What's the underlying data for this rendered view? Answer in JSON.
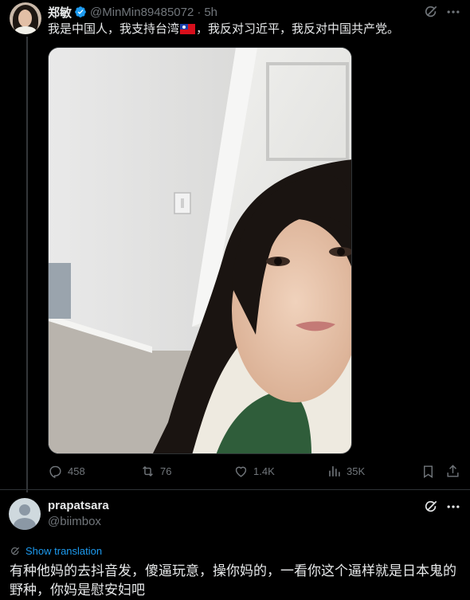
{
  "tweet": {
    "author_name": "郑敏",
    "author_handle": "@MinMin89485072",
    "separator": "·",
    "time": "5h",
    "text_part1": "我是中国人，我支持台湾",
    "text_part2": "，我反对习近平，我反对中国共产党。",
    "flag_icon": "taiwan-flag-emoji",
    "stats": {
      "replies": "458",
      "reposts": "76",
      "likes": "1.4K",
      "views": "35K"
    }
  },
  "reply": {
    "author_name": "prapatsara",
    "author_handle": "@biimbox",
    "show_translation": "Show translation",
    "text": "有种他妈的去抖音发，傻逼玩意，操你妈的，一看你这个逼样就是日本鬼的野种，你妈是慰安妇吧"
  },
  "colors": {
    "background": "#000000",
    "text": "#e7e9ea",
    "secondary": "#71767b",
    "accent": "#1d9bf0",
    "divider": "#2f3336"
  }
}
